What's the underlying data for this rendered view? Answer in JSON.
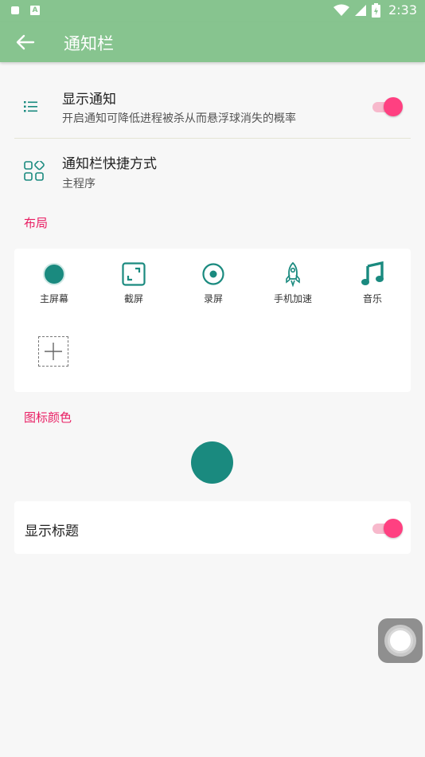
{
  "status_bar": {
    "time": "2:33"
  },
  "header": {
    "title": "通知栏"
  },
  "settings": {
    "show_notification": {
      "title": "显示通知",
      "subtitle": "开启通知可降低进程被杀从而悬浮球消失的概率",
      "enabled": true
    },
    "shortcut": {
      "title": "通知栏快捷方式",
      "subtitle": "主程序"
    }
  },
  "layout_section": {
    "label": "布局",
    "items": [
      {
        "label": "主屏幕",
        "icon": "circle-filled-icon"
      },
      {
        "label": "截屏",
        "icon": "screenshot-icon"
      },
      {
        "label": "录屏",
        "icon": "record-icon"
      },
      {
        "label": "手机加速",
        "icon": "rocket-icon"
      },
      {
        "label": "音乐",
        "icon": "music-note-icon"
      }
    ],
    "add_icon": "plus-icon"
  },
  "icon_color_section": {
    "label": "图标颜色",
    "color": "#1a8a7f"
  },
  "show_title": {
    "label": "显示标题",
    "enabled": true
  },
  "colors": {
    "accent": "#ff4081",
    "primary": "#87c48f",
    "icon": "#1a8a7f",
    "section": "#e91e63"
  }
}
